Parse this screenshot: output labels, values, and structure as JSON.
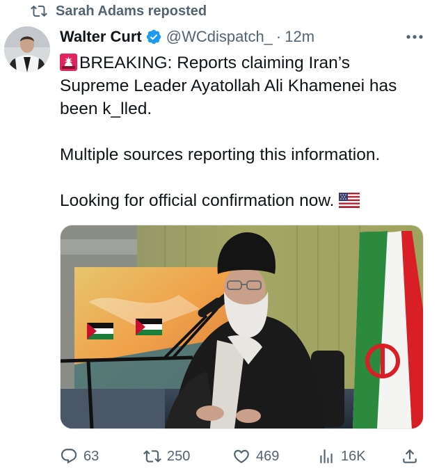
{
  "repost": {
    "icon": "repost-icon",
    "text": "Sarah Adams reposted"
  },
  "author": {
    "display_name": "Walter Curt",
    "verified": true,
    "handle": "@WCdispatch_",
    "separator": "·",
    "time": "12m"
  },
  "tweet": {
    "line1_prefix_emoji": "rotating-light-emoji",
    "line1": "BREAKING: Reports claiming Iran’s",
    "line2": "Supreme Leader Ayatollah Ali Khamenei has",
    "line3": "been k_lled.",
    "line4": "Multiple sources reporting this information.",
    "line5": "Looking for official confirmation now.",
    "line5_suffix_emoji": "us-flag-emoji"
  },
  "actions": {
    "replies": "63",
    "reposts": "250",
    "likes": "469",
    "views": "16K"
  },
  "colors": {
    "text_primary": "#0f1419",
    "text_secondary": "#536471",
    "verified_blue": "#1d9bf0"
  }
}
